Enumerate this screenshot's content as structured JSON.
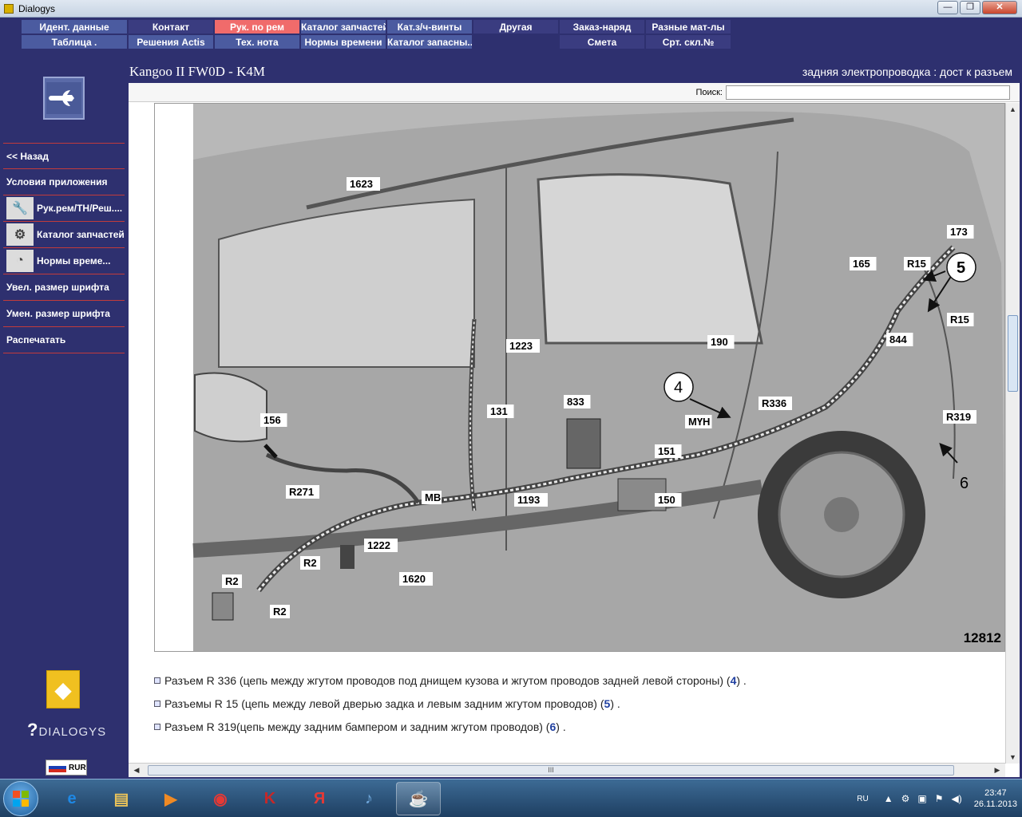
{
  "window": {
    "title": "Dialogys",
    "btn_min": "—",
    "btn_max": "❐",
    "btn_close": "✕"
  },
  "menu": [
    {
      "label": "Идент. данные",
      "state": "normal"
    },
    {
      "label": "Контакт",
      "state": "dark"
    },
    {
      "label": "Рук. по рем",
      "state": "active"
    },
    {
      "label": "Каталог запчастей",
      "state": "normal"
    },
    {
      "label": "Кат.з/ч-винты",
      "state": "normal"
    },
    {
      "label": "Другая",
      "state": "dark"
    },
    {
      "label": "Заказ-наряд",
      "state": "dark"
    },
    {
      "label": "Разные мат-лы",
      "state": "dark"
    },
    {
      "label": "Таблица .",
      "state": "normal"
    },
    {
      "label": "Решения Actis",
      "state": "normal"
    },
    {
      "label": "Тех. нота",
      "state": "normal"
    },
    {
      "label": "Нормы времени",
      "state": "normal"
    },
    {
      "label": "Каталог запасны...",
      "state": "normal"
    },
    {
      "label": "",
      "state": "empty"
    },
    {
      "label": "Смета",
      "state": "dark"
    },
    {
      "label": "Срт. скл.№",
      "state": "dark"
    }
  ],
  "header": {
    "vehicle": "Kangoo II FW0D - K4M",
    "section": "задняя электропроводка : дост к разъем"
  },
  "sidebar": {
    "items": [
      {
        "label": "<< Назад",
        "icon": ""
      },
      {
        "label": "Условия приложения",
        "icon": ""
      },
      {
        "label": "Рук.рем/ТН/Реш....",
        "icon": "wrench-icon"
      },
      {
        "label": "Каталог запчастей",
        "icon": "parts-icon"
      },
      {
        "label": "Нормы време...",
        "icon": "clock-icon"
      },
      {
        "label": "Увел. размер шрифта",
        "icon": ""
      },
      {
        "label": "Умен. размер шрифта",
        "icon": ""
      },
      {
        "label": "Распечатать",
        "icon": ""
      }
    ],
    "brand": "DIALOGYS",
    "currency": "RUR"
  },
  "search": {
    "label": "Поиск:",
    "value": ""
  },
  "diagram": {
    "figure_number": "12812",
    "labels": [
      "1623",
      "173",
      "165",
      "R15",
      "5",
      "R15",
      "844",
      "1223",
      "190",
      "4",
      "R336",
      "833",
      "131",
      "МҮН",
      "R319",
      "156",
      "151",
      "6",
      "R271",
      "МВ",
      "1193",
      "150",
      "1222",
      "R2",
      "1620",
      "R2",
      "R2"
    ],
    "callouts": [
      "4",
      "5",
      "6"
    ]
  },
  "descriptions": [
    {
      "text": "Разъем R 336 (цепь между жгутом проводов под днищем кузова и жгутом проводов задней левой стороны) (",
      "ref": "4",
      "tail": ") ."
    },
    {
      "text": "Разъемы R 15 (цепь между левой дверью задка и левым задним жгутом проводов) (",
      "ref": "5",
      "tail": ") ."
    },
    {
      "text": "Разъем R 319(цепь между задним бампером и задним жгутом проводов) (",
      "ref": "6",
      "tail": ") ."
    }
  ],
  "scroll": {
    "h_thumb": "III",
    "arrow_up": "▲",
    "arrow_down": "▼",
    "arrow_left": "◀",
    "arrow_right": "▶"
  },
  "taskbar": {
    "apps": [
      {
        "name": "ie-icon",
        "glyph": "e",
        "open": false
      },
      {
        "name": "explorer-icon",
        "glyph": "▤",
        "open": false
      },
      {
        "name": "media-player-icon",
        "glyph": "▶",
        "open": false
      },
      {
        "name": "chrome-icon",
        "glyph": "◉",
        "open": false
      },
      {
        "name": "kaspersky-icon",
        "glyph": "K",
        "open": false
      },
      {
        "name": "yandex-icon",
        "glyph": "Я",
        "open": false
      },
      {
        "name": "speaker-app-icon",
        "glyph": "♪",
        "open": false
      },
      {
        "name": "java-icon",
        "glyph": "☕",
        "open": true
      }
    ],
    "lang": "RU",
    "time": "23:47",
    "date": "26.11.2013"
  },
  "colors": {
    "app_bg": "#2e306f",
    "menu_bg": "#4b5ba0",
    "menu_active": "#f06b6b",
    "separator": "#c23b3b"
  }
}
